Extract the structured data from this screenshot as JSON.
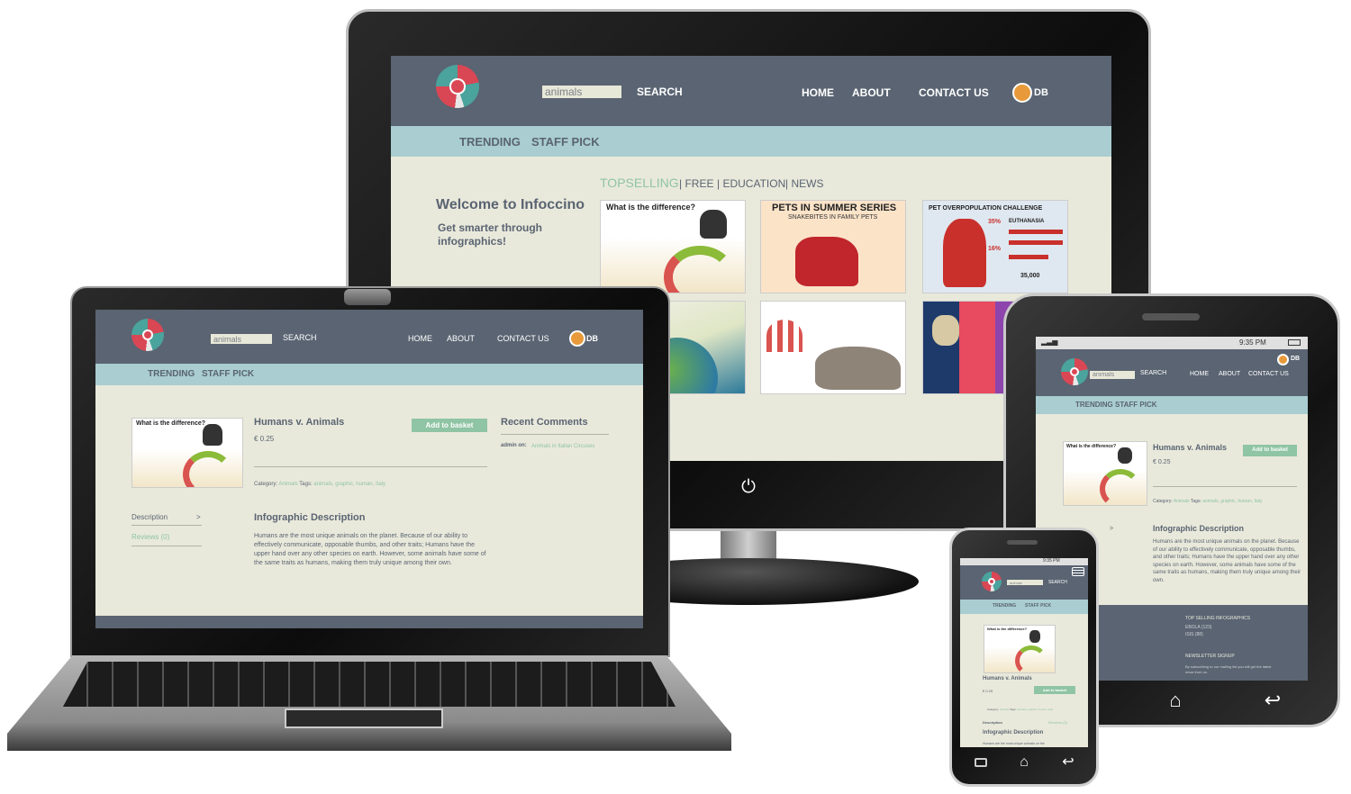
{
  "site": {
    "search_value": "animals",
    "search_label": "SEARCH",
    "nav": [
      "HOME",
      "ABOUT",
      "CONTACT US"
    ],
    "user_initials": "DB",
    "subnav": [
      "TRENDING",
      "STAFF PICK"
    ]
  },
  "desktop": {
    "filters": [
      "TOPSELLING",
      "| FREE",
      "| EDUCATION",
      "| NEWS"
    ],
    "welcome_title": "Welcome to Infoccino",
    "welcome_sub": "Get  smarter through infographics!",
    "thumbs": [
      {
        "title": "What is the difference?"
      },
      {
        "title": "PETS IN SUMMER SERIES",
        "subtitle": "SNAKEBITES IN FAMILY PETS"
      },
      {
        "title": "PET OVERPOPULATION CHALLENGE",
        "stat_label": "EUTHANASIA",
        "stats": [
          "35%",
          "16%",
          "35,000"
        ]
      },
      {
        "title": ""
      },
      {
        "title": ""
      },
      {
        "title": ""
      }
    ]
  },
  "product": {
    "title": "Humans v. Animals",
    "price": "€ 0.25",
    "add_label": "Add to basket",
    "thumb_title": "What is the difference?",
    "category_label": "Category:",
    "category": "Animals",
    "tags_label": "Tags:",
    "tags": "animals, graphic, human, Italy",
    "tab_description": "Description",
    "tab_chevron": ">",
    "tab_reviews": "Reviews (0)",
    "desc_title": "Infographic Description",
    "desc_text": "Humans are the most unique animals on the planet. Because of our ability to effectively communicate, opposable thumbs, and other traits; Humans have the upper hand over any other species on earth. However, some animals have some of the same traits as humans, making them truly unique among their own.",
    "phone_desc_snippet": "Humans are the most unique animals on the",
    "recent_comments_title": "Recent Comments",
    "comment_author": "admin on:",
    "comment_link": "Animals in Italian Circuses"
  },
  "tablet": {
    "status_time": "9:35 PM",
    "footer_heading": "TOP SELLING INFOGRAPHICS",
    "footer_items": [
      "EBOLA (123)",
      "ISIS (88)"
    ],
    "newsletter_heading": "NEWSLETTER SIGNUP",
    "newsletter_text": "By subscribing to our mailing list you will get the latest news from us."
  },
  "phone": {
    "status_time": "9:35 PM"
  },
  "colors": {
    "header": "#5a6472",
    "subbar": "#a9cdd0",
    "body": "#e9e9db",
    "accent": "#8fc4a4",
    "logo_red": "#d94755",
    "logo_teal": "#4aa39c"
  },
  "icons": [
    "power-icon",
    "home-icon",
    "back-icon",
    "recent-apps-icon",
    "menu-icon",
    "webcam-icon"
  ]
}
